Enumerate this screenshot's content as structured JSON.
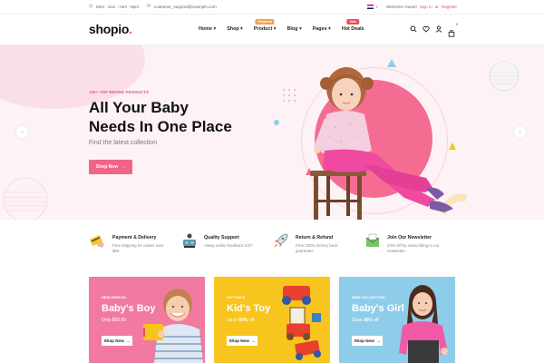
{
  "topbar": {
    "hours": "Mon - Sun : 7am - 8pm",
    "email": "customer_support@example.com",
    "welcome": "Welcome Guest!",
    "sign_in": "Sign in",
    "or": "or",
    "register": "Register"
  },
  "header": {
    "logo_text": "shopio",
    "logo_dot": ".",
    "nav": [
      {
        "label": "Home",
        "badge": ""
      },
      {
        "label": "Shop",
        "badge": ""
      },
      {
        "label": "Product",
        "badge": "Featured"
      },
      {
        "label": "Blog",
        "badge": ""
      },
      {
        "label": "Pages",
        "badge": ""
      },
      {
        "label": "Hot Deals",
        "badge": "Sale"
      }
    ],
    "cart_count": "0"
  },
  "hero": {
    "eyebrow": "100+ TOP BRAND PRODUCTS",
    "title_line1": "All Your Baby",
    "title_line2": "Needs In One Place",
    "subtitle": "Find the latest collection",
    "button": "Shop Now"
  },
  "features": [
    {
      "icon": "card-icon",
      "title": "Payment & Delivery",
      "desc": "Free shipping for orders over $59"
    },
    {
      "icon": "support-icon",
      "title": "Quality Support",
      "desc": "Alway online feedback 24/7"
    },
    {
      "icon": "rocket-icon",
      "title": "Return & Refund",
      "desc": "Free 100% money back guarantee"
    },
    {
      "icon": "mail-icon",
      "title": "Join Our Newsletter",
      "desc": "20% Off by subscribing to our newsletter"
    }
  ],
  "banners": [
    {
      "tag": "NEW ARRIVAL",
      "title": "Baby's Boy",
      "price_prefix": "Only",
      "price": "$59.99",
      "price_suffix": "",
      "button": "Shop Now",
      "color": "#f27aa0"
    },
    {
      "tag": "HOT SALE",
      "title": "Kid's Toy",
      "price_prefix": "Up to",
      "price": "60%",
      "price_suffix": "off",
      "button": "Shop Now",
      "color": "#f7c51d"
    },
    {
      "tag": "NEW COLLECTION",
      "title": "Baby's Girl",
      "price_prefix": "Save",
      "price": "30%",
      "price_suffix": "off",
      "button": "Shop Now",
      "color": "#8ecdea"
    }
  ],
  "colors": {
    "accent": "#e84f7a",
    "featured_badge": "#f3a14b",
    "sale_badge": "#e8505b"
  }
}
